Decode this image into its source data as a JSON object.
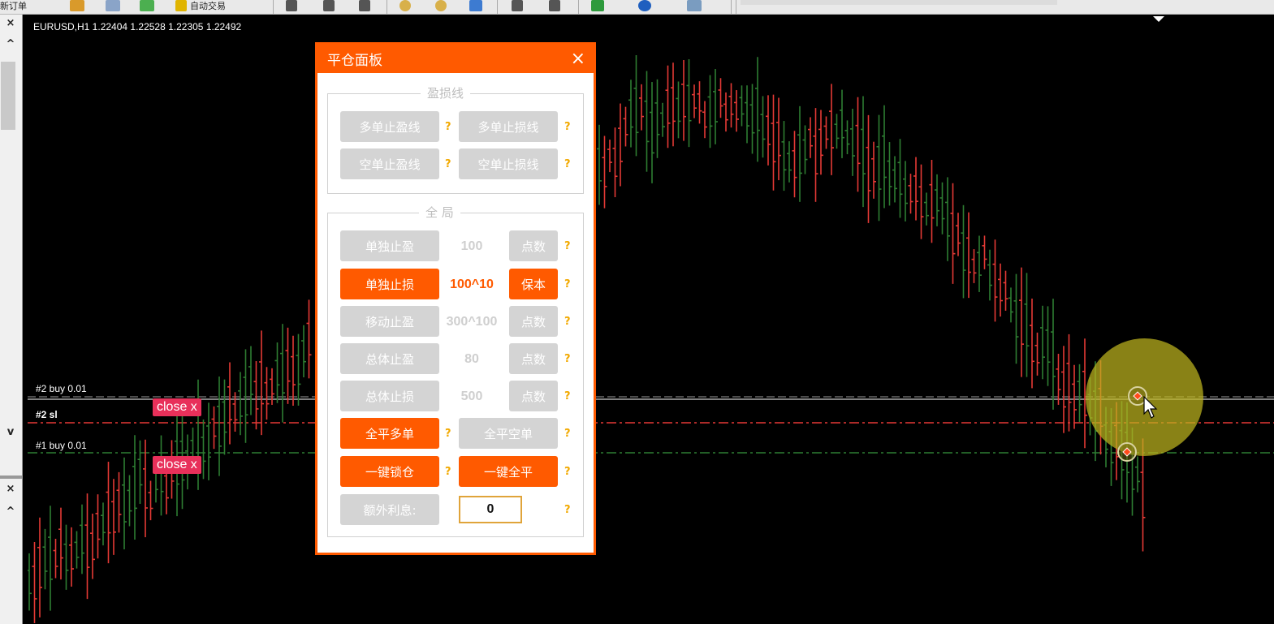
{
  "toolbar": {
    "left_partial_label": "新订单",
    "expert_partial_label": "自动交易"
  },
  "left_panel": {
    "close_top": "×",
    "scroll_up": "^",
    "scroll_down": "v",
    "close_bottom": "×",
    "scroll_up_bottom": "^"
  },
  "chart": {
    "symbol_info": "EURUSD,H1  1.22404 1.22528 1.22305 1.22492",
    "orders": [
      {
        "label": "#2 buy 0.01",
        "close": "close x"
      },
      {
        "label": "#2 sl"
      },
      {
        "label": "#1 buy 0.01",
        "close": "close x"
      }
    ],
    "bull_color": "#2e7d32",
    "bear_color": "#e53935"
  },
  "panel": {
    "title": "平仓面板",
    "close_icon": "×",
    "group1_title": "盈损线",
    "group2_title": "全  局",
    "btn_long_tp_line": "多单止盈线",
    "btn_long_sl_line": "多单止损线",
    "btn_short_tp_line": "空单止盈线",
    "btn_short_sl_line": "空单止损线",
    "btn_single_tp": "单独止盈",
    "val_single_tp": "100",
    "btn_single_tp_unit": "点数",
    "btn_single_sl": "单独止损",
    "val_single_sl": "100^10",
    "btn_single_sl_unit": "保本",
    "btn_trailing": "移动止盈",
    "val_trailing": "300^100",
    "btn_trailing_unit": "点数",
    "btn_total_tp": "总体止盈",
    "val_total_tp": "80",
    "btn_total_tp_unit": "点数",
    "btn_total_sl": "总体止损",
    "val_total_sl": "500",
    "btn_total_sl_unit": "点数",
    "btn_close_all_long": "全平多单",
    "btn_close_all_short": "全平空单",
    "btn_lock": "一键锁仓",
    "btn_close_all": "一键全平",
    "btn_extra_interest": "额外利息:",
    "extra_interest_value": "0",
    "help": "?",
    "accent": "#ff5a00"
  }
}
